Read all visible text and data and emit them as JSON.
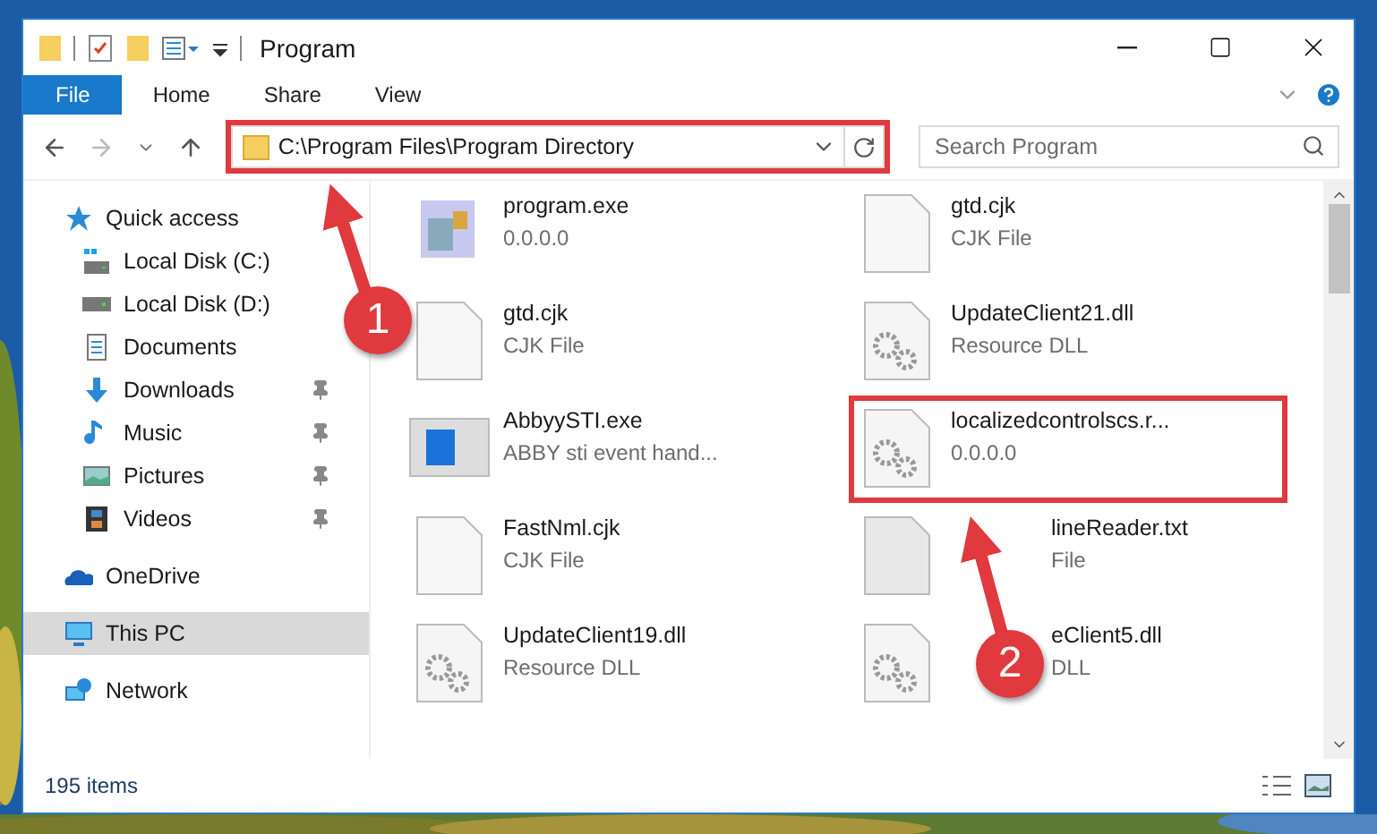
{
  "window": {
    "title": "Program"
  },
  "ribbon_tabs": [
    {
      "label": "File",
      "kind": "file"
    },
    {
      "label": "Home",
      "kind": "tab"
    },
    {
      "label": "Share",
      "kind": "tab"
    },
    {
      "label": "View",
      "kind": "tab"
    }
  ],
  "address": {
    "path": "C:\\Program Files\\Program Directory",
    "highlighted": true
  },
  "search": {
    "placeholder": "Search Program"
  },
  "sidebar": {
    "items": [
      {
        "label": "Quick access",
        "kind": "star",
        "selected": false,
        "pinned": false,
        "children": [
          {
            "label": "Local Disk (C:)",
            "kind": "disk-c",
            "selected": false,
            "pinned": false
          },
          {
            "label": "Local Disk (D:)",
            "kind": "disk",
            "selected": false,
            "pinned": false
          },
          {
            "label": "Documents",
            "kind": "document",
            "selected": false,
            "pinned": false
          },
          {
            "label": "Downloads",
            "kind": "download",
            "selected": false,
            "pinned": true
          },
          {
            "label": "Music",
            "kind": "music",
            "selected": false,
            "pinned": true
          },
          {
            "label": "Pictures",
            "kind": "pictures",
            "selected": false,
            "pinned": true
          },
          {
            "label": "Videos",
            "kind": "videos",
            "selected": false,
            "pinned": true
          }
        ]
      },
      {
        "label": "OneDrive",
        "kind": "cloud",
        "selected": false,
        "pinned": false
      },
      {
        "label": "This PC",
        "kind": "pc",
        "selected": true,
        "pinned": false
      },
      {
        "label": "Network",
        "kind": "network",
        "selected": false,
        "pinned": false
      }
    ]
  },
  "files": [
    {
      "name": "program.exe",
      "detail": "0.0.0.0",
      "kind": "program",
      "highlighted": false,
      "covered": false
    },
    {
      "name": "gtd.cjk",
      "detail": "CJK File",
      "kind": "blank",
      "highlighted": false,
      "covered": false
    },
    {
      "name": "gtd.cjk",
      "detail": "CJK File",
      "kind": "blank",
      "highlighted": false,
      "covered": false
    },
    {
      "name": "UpdateClient21.dll",
      "detail": "Resource DLL",
      "kind": "gears",
      "highlighted": false,
      "covered": false
    },
    {
      "name": "AbbyySTI.exe",
      "detail": "ABBY sti event hand...",
      "kind": "window",
      "highlighted": false,
      "covered": false
    },
    {
      "name": "localizedcontrolscs.r...",
      "detail": "0.0.0.0",
      "kind": "gears",
      "highlighted": true,
      "covered": false
    },
    {
      "name": "FastNml.cjk",
      "detail": "CJK File",
      "kind": "blank",
      "highlighted": false,
      "covered": false
    },
    {
      "name": "lineReader.txt",
      "detail": "File",
      "kind": "grey",
      "highlighted": false,
      "covered": true
    },
    {
      "name": "UpdateClient19.dll",
      "detail": "Resource DLL",
      "kind": "gears",
      "highlighted": false,
      "covered": false
    },
    {
      "name": "eClient5.dll",
      "detail": "DLL",
      "kind": "gears",
      "highlighted": false,
      "covered": true
    }
  ],
  "status_bar": {
    "count": "195 items"
  },
  "annotations": [
    {
      "number": "1"
    },
    {
      "number": "2"
    }
  ]
}
